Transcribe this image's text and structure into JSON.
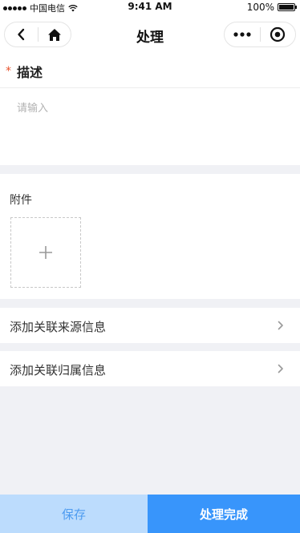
{
  "status_bar": {
    "carrier": "中国电信",
    "time": "9:41 AM",
    "battery": "100%",
    "signal_icon": "signal-dots-icon",
    "wifi_icon": "wifi-icon",
    "battery_icon": "battery-icon"
  },
  "nav": {
    "title": "处理",
    "back_icon": "chevron-left-icon",
    "home_icon": "home-icon",
    "more_icon": "more-dots-icon",
    "close_icon": "target-circle-icon"
  },
  "form": {
    "description": {
      "required_mark": "*",
      "label": "描述",
      "placeholder": "请输入",
      "value": ""
    },
    "attachment": {
      "label": "附件",
      "upload_icon": "plus-icon"
    },
    "links": [
      {
        "label": "添加关联来源信息",
        "icon": "chevron-right-icon"
      },
      {
        "label": "添加关联归属信息",
        "icon": "chevron-right-icon"
      }
    ]
  },
  "actions": {
    "save_label": "保存",
    "complete_label": "处理完成"
  },
  "colors": {
    "primary": "#3895fb",
    "save_bg": "#bcdcfd",
    "save_text": "#4d9bf0",
    "required": "#e8542e",
    "page_bg": "#f0f1f5"
  }
}
